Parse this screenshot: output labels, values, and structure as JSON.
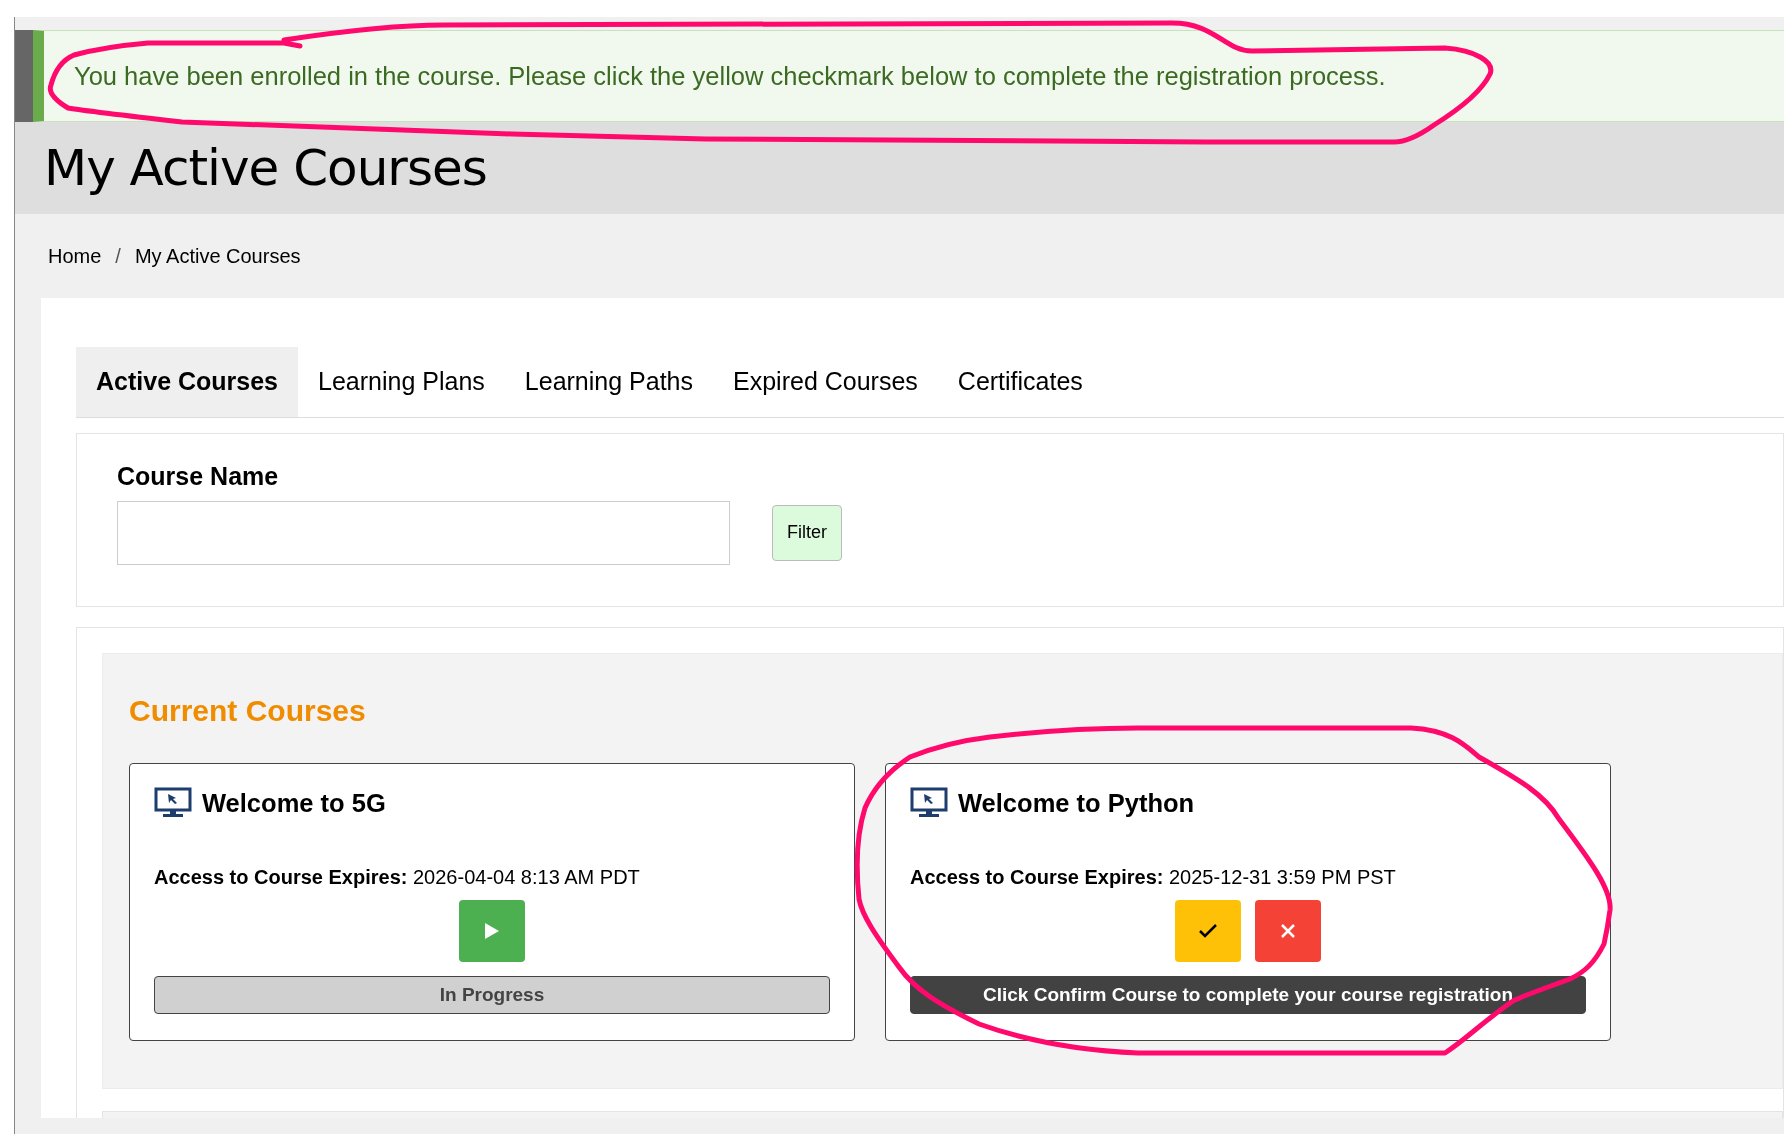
{
  "alert": {
    "message": "You have been enrolled in the course. Please click the yellow checkmark below to complete the registration process."
  },
  "page_title": "My Active Courses",
  "breadcrumb": [
    "Home",
    "My Active Courses"
  ],
  "breadcrumb_separator": "/",
  "tabs": [
    {
      "label": "Active Courses",
      "selected": true
    },
    {
      "label": "Learning Plans",
      "selected": false
    },
    {
      "label": "Learning Paths",
      "selected": false
    },
    {
      "label": "Expired Courses",
      "selected": false
    },
    {
      "label": "Certificates",
      "selected": false
    }
  ],
  "filter": {
    "label": "Course Name",
    "button": "Filter"
  },
  "section_title": "Current Courses",
  "courses": [
    {
      "title": "Welcome to 5G",
      "expires_label": "Access to Course Expires:",
      "expires": "2026-04-04 8:13 AM PDT",
      "actions": [
        {
          "kind": "play"
        }
      ],
      "status": {
        "kind": "progress",
        "text": "In Progress"
      }
    },
    {
      "title": "Welcome to Python",
      "expires_label": "Access to Course Expires:",
      "expires": "2025-12-31 3:59 PM PST",
      "actions": [
        {
          "kind": "confirm"
        },
        {
          "kind": "decline"
        }
      ],
      "status": {
        "kind": "notice",
        "text": "Click Confirm Course to complete your course registration"
      }
    }
  ]
}
